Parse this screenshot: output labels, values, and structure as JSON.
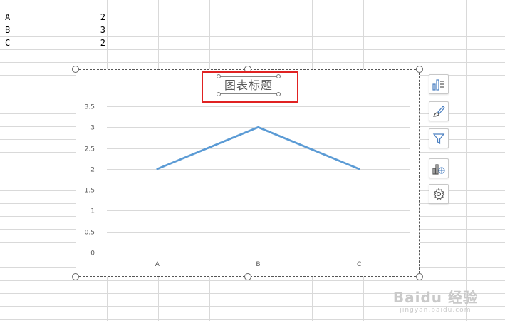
{
  "sheet": {
    "rows": [
      {
        "label": "A",
        "value": "2"
      },
      {
        "label": "B",
        "value": "3"
      },
      {
        "label": "C",
        "value": "2"
      }
    ]
  },
  "chart": {
    "title": "图表标题",
    "highlight_color": "#e02222"
  },
  "chart_data": {
    "type": "line",
    "categories": [
      "A",
      "B",
      "C"
    ],
    "values": [
      2,
      3,
      2
    ],
    "title": "图表标题",
    "ylim": [
      0,
      3.5
    ],
    "y_ticks": [
      "3.5",
      "3",
      "2.5",
      "2",
      "1.5",
      "1",
      "0.5",
      "0"
    ],
    "grid": true,
    "series_color": "#5b9bd5"
  },
  "tools": [
    {
      "name": "chart-elements-icon"
    },
    {
      "name": "chart-style-icon"
    },
    {
      "name": "chart-filter-icon"
    },
    {
      "name": "chart-type-icon"
    },
    {
      "name": "settings-icon"
    }
  ],
  "watermark": {
    "main": "Baidu 经验",
    "sub": "jingyan.baidu.com"
  }
}
